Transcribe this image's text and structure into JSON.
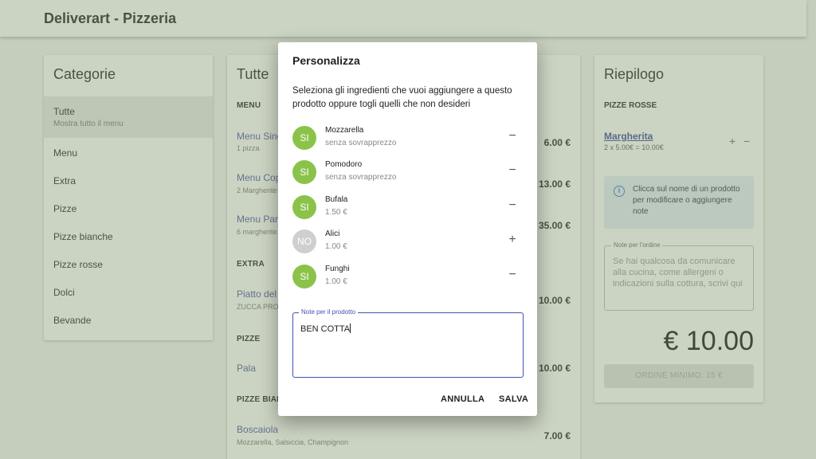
{
  "app": {
    "title": "Deliverart - Pizzeria"
  },
  "categories": {
    "title": "Categorie",
    "active": {
      "label": "Tutte",
      "sub": "Mostra tutto il menu"
    },
    "items": [
      "Menu",
      "Extra",
      "Pizze",
      "Pizze bianche",
      "Pizze rosse",
      "Dolci",
      "Bevande"
    ]
  },
  "products": {
    "title": "Tutte",
    "sections": [
      {
        "label": "MENU"
      },
      {
        "label": "EXTRA"
      },
      {
        "label": "PIZZE"
      },
      {
        "label": "PIZZE BIAN"
      }
    ],
    "items": [
      {
        "name": "Menu Sing",
        "sub": "1 pizza",
        "price": "6.00 €"
      },
      {
        "name": "Menu Cop",
        "sub": "2 Margherite",
        "price": "13.00 €"
      },
      {
        "name": "Menu Par",
        "sub": "6 margherite",
        "price": "35.00 €"
      },
      {
        "name": "Piatto del",
        "sub": "ZUCCA PROV",
        "price": "10.00 €"
      },
      {
        "name": "Pala",
        "sub": "",
        "price": "10.00 €"
      },
      {
        "name": "Boscaiola",
        "sub": "Mozzarella, Salsiccia, Champignon",
        "price": "7.00 €"
      }
    ]
  },
  "summary": {
    "title": "Riepilogo",
    "section": "PIZZE ROSSE",
    "item": {
      "name": "Margherita",
      "sub": "2 x 5.00€ = 10.00€",
      "plus": "+",
      "minus": "−"
    },
    "info": {
      "icon": "i",
      "text": "Clicca sul nome di un prodotto per modificare o aggiungere note"
    },
    "notes": {
      "label": "Note per l'ordine",
      "placeholder": "Se hai qualcosa da comunicare alla cucina, come allergeni o indicazioni sulla cottura, scrivi qui"
    },
    "total": "€ 10.00",
    "order_button": "ORDINE MINIMO: 15 €"
  },
  "dialog": {
    "title": "Personalizza",
    "description": "Seleziona gli ingredienti che vuoi aggiungere a questo prodotto oppure togli quelli che non desideri",
    "ingredients": [
      {
        "badge": "SI",
        "name": "Mozzarella",
        "price": "senza sovrapprezzo",
        "action": "−",
        "color": "#8bc34a"
      },
      {
        "badge": "SI",
        "name": "Pomodoro",
        "price": "senza sovrapprezzo",
        "action": "−",
        "color": "#8bc34a"
      },
      {
        "badge": "SI",
        "name": "Bufala",
        "price": "1.50 €",
        "action": "−",
        "color": "#8bc34a"
      },
      {
        "badge": "NO",
        "name": "Alici",
        "price": "1.00 €",
        "action": "+",
        "color": "#cfcfcf"
      },
      {
        "badge": "SI",
        "name": "Funghi",
        "price": "1.00 €",
        "action": "−",
        "color": "#8bc34a"
      }
    ],
    "notes": {
      "label": "Note per il prodotto",
      "value": "BEN COTTA"
    },
    "cancel": "ANNULLA",
    "save": "SALVA"
  }
}
